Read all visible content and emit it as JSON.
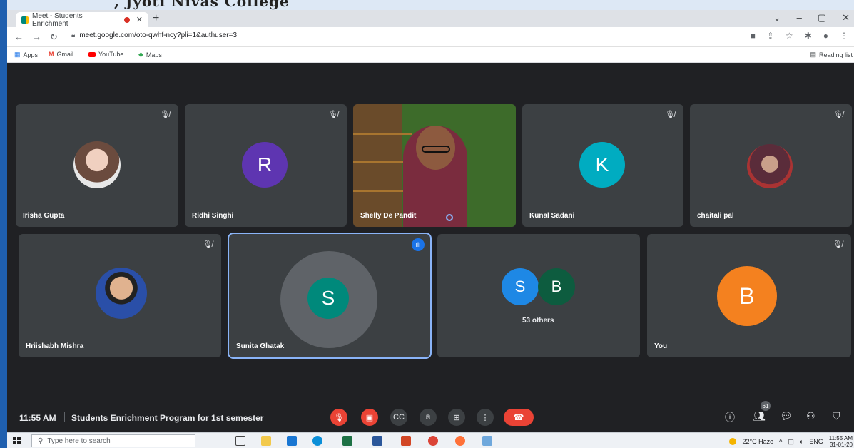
{
  "header_band": {
    "text": ", Jyoti Nivas College"
  },
  "browser": {
    "tab_title": "Meet - Students Enrichment",
    "url": "meet.google.com/oto-qwhf-ncy?pli=1&authuser=3",
    "bookmarks": [
      "Apps",
      "Gmail",
      "YouTube",
      "Maps"
    ],
    "reading_list": "Reading list"
  },
  "participants": [
    {
      "name": "Irisha Gupta",
      "kind": "photo",
      "muted": true
    },
    {
      "name": "Ridhi Singhi",
      "kind": "initial",
      "initial": "R",
      "color": "#5e35b1",
      "muted": true
    },
    {
      "name": "Shelly De Pandit",
      "kind": "video",
      "muted": false
    },
    {
      "name": "Kunal Sadani",
      "kind": "initial",
      "initial": "K",
      "color": "#00acc1",
      "muted": true
    },
    {
      "name": "chaitali pal",
      "kind": "photo",
      "muted": true
    },
    {
      "name": "Hriishabh Mishra",
      "kind": "photo",
      "muted": true
    },
    {
      "name": "Sunita Ghatak",
      "kind": "initial",
      "initial": "S",
      "color": "#00897b",
      "speaking": true
    },
    {
      "name": "",
      "kind": "group",
      "initials": [
        "S",
        "B"
      ],
      "label": "53 others"
    },
    {
      "name": "You",
      "kind": "initial",
      "initial": "B",
      "color": "#f4811f",
      "muted": true
    }
  ],
  "bottom_bar": {
    "time": "11:55 AM",
    "meeting_name": "Students Enrichment Program for 1st semester",
    "participant_count": "61"
  },
  "taskbar": {
    "search_placeholder": "Type here to search",
    "weather": "22°C Haze",
    "language": "ENG",
    "time": "11:55 AM",
    "date": "31-01-20"
  },
  "colors": {
    "accent": "#1a73e8",
    "danger": "#ea4335",
    "meet_bg": "#202124",
    "tile": "#3c4043"
  }
}
